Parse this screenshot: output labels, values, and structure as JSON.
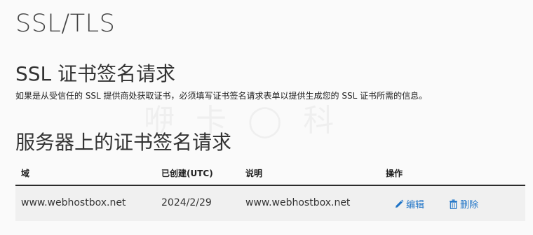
{
  "page": {
    "title": "SSL/TLS"
  },
  "csr_section": {
    "title": "SSL 证书签名请求",
    "description": "如果是从受信任的 SSL 提供商处获取证书，必须填写证书签名请求表单以提供生成您的 SSL 证书所需的信息。"
  },
  "server_csr": {
    "title": "服务器上的证书签名请求",
    "columns": [
      "域",
      "已创建(UTC)",
      "说明",
      "操作"
    ],
    "rows": [
      {
        "domain": "www.webhostbox.net",
        "created": "2024/2/29",
        "description": "www.webhostbox.net",
        "edit_label": "编辑",
        "delete_label": "删除"
      }
    ]
  },
  "icons": {
    "edit": "pencil-icon",
    "delete": "trash-icon"
  },
  "colors": {
    "action_link": "#1f74c7",
    "table_header_rule": "#2b2b2b",
    "row_background": "#f0f0f0"
  }
}
